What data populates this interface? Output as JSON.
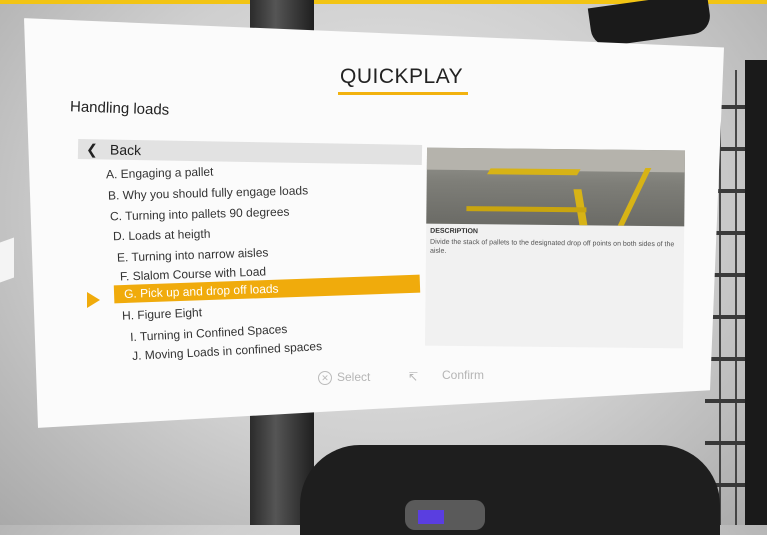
{
  "menu": {
    "title": "QUICKPLAY",
    "heading": "Handling loads",
    "back_label": "Back",
    "items": [
      "A. Engaging a pallet",
      "B. Why you should fully engage loads",
      "C. Turning into pallets 90 degrees",
      "D. Loads at heigth",
      "E. Turning into narrow aisles",
      "F. Slalom Course with Load",
      "G. Pick up and drop off loads",
      "H. Figure Eight",
      "I. Turning in Confined Spaces",
      "J. Moving Loads in confined spaces"
    ],
    "selected_index": 6
  },
  "preview": {
    "desc_title": "DESCRIPTION",
    "desc_text": "Divide the stack of pallets to the designated drop off points on both sides of the aisle."
  },
  "footer": {
    "select_label": "Select",
    "confirm_label": "Confirm"
  },
  "colors": {
    "accent": "#f0ab0c",
    "panel": "#fbfbfb"
  }
}
